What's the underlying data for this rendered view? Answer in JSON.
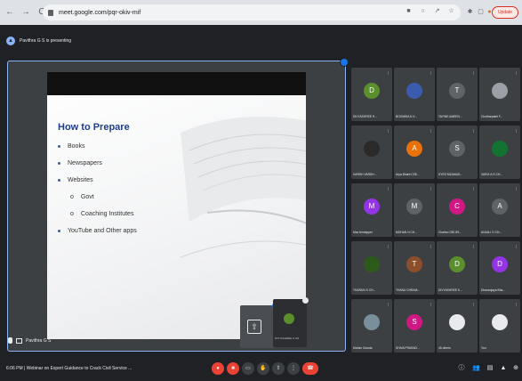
{
  "browser": {
    "back": "←",
    "forward": "→",
    "reload": "C",
    "url": "meet.google.com/pqr-okiv-mif",
    "update_label": "Update"
  },
  "meet": {
    "presenting_text": "Pavithra G S is presenting",
    "presenter_name": "Pavithra G S"
  },
  "slide": {
    "title": "How to Prepare",
    "bullets": [
      "Books",
      "Newspapers",
      "Websites",
      "YouTube and Other apps"
    ],
    "sub_bullets": [
      "Govt",
      "Coaching Institutes"
    ],
    "sub_marker": "o"
  },
  "self_view": {
    "name": "DIVYASHREE H GS"
  },
  "participants": [
    {
      "initial": "D",
      "color": "#5b8f2d",
      "name": "DIVYASHREE H..."
    },
    {
      "initial": "",
      "color": "#3b5cae",
      "name": "BOOMIKA K.V..."
    },
    {
      "initial": "T",
      "color": "#5f6368",
      "name": "TAYINE AMEEN..."
    },
    {
      "initial": "",
      "color": "#9aa0a6",
      "name": "Chotharpatel F..."
    },
    {
      "initial": "",
      "color": "#2a2a2a",
      "name": "HARSH VARDH..."
    },
    {
      "initial": "A",
      "color": "#e8710a",
      "name": "Arya Bharti CSE..."
    },
    {
      "initial": "S",
      "color": "#5f6368",
      "name": "SYED MZAMUD..."
    },
    {
      "initial": "",
      "color": "#137333",
      "name": "VASVI A G CH..."
    },
    {
      "initial": "M",
      "color": "#9334e6",
      "name": "Mac ferctapper"
    },
    {
      "initial": "M",
      "color": "#5f6368",
      "name": "MOHAN N CH..."
    },
    {
      "initial": "C",
      "color": "#d01884",
      "name": "Chaitra CSE-59..."
    },
    {
      "initial": "A",
      "color": "#5f6368",
      "name": "ANJALI G CH..."
    },
    {
      "initial": "",
      "color": "#2d5a1b",
      "name": "THARUN S CH..."
    },
    {
      "initial": "T",
      "color": "#8d4f2b",
      "name": "THANU CHRAM..."
    },
    {
      "initial": "D",
      "color": "#5b8f2d",
      "name": "DIVYASHREE K..."
    },
    {
      "initial": "D",
      "color": "#9334e6",
      "name": "Dhananjaya Bha..."
    },
    {
      "initial": "",
      "color": "#7a8f9c",
      "name": "Mohan Gowda"
    },
    {
      "initial": "S",
      "color": "#d01884",
      "name": "SHIVA PRASAD..."
    },
    {
      "initial": "",
      "color": "#e8eaed",
      "name": "45 others"
    },
    {
      "initial": "",
      "color": "#e8eaed",
      "name": "You"
    }
  ],
  "bottom": {
    "time": "6:06 PM",
    "meeting_title": "Webinar on Expert Guidance to Crack Civil Service ...",
    "separator": "|",
    "controls": [
      "mic-off",
      "camera-off",
      "captions",
      "raise-hand",
      "present",
      "more",
      "end-call"
    ],
    "right_icons": [
      "info",
      "people",
      "chat",
      "activities",
      "lock"
    ]
  },
  "colors": {
    "accent": "#8ab4f8",
    "danger": "#ea4335",
    "background": "#202124",
    "tile": "#3c4043",
    "slide_title": "#1f3f8a"
  }
}
